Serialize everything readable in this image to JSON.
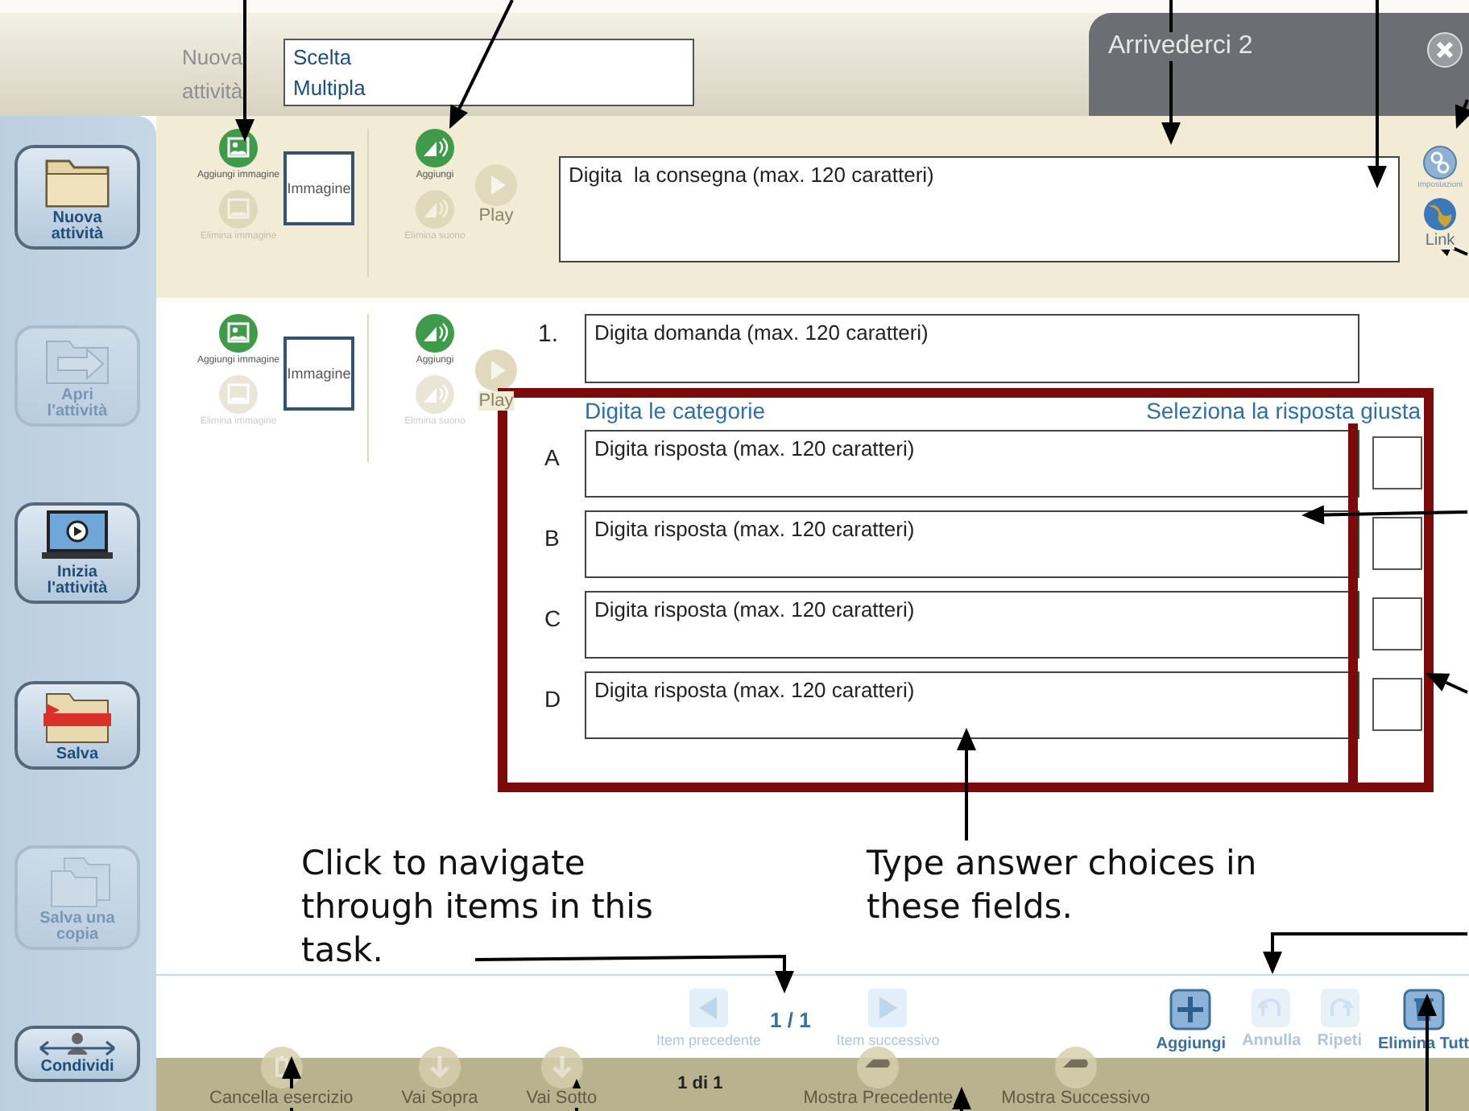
{
  "header": {
    "label": "Nuova attività",
    "activity_name_lines": [
      "Scelta",
      "Multipla"
    ]
  },
  "window_tab": {
    "title": "Arrivederci 2"
  },
  "sidebar": {
    "items": [
      {
        "kind": "new",
        "label": "Nuova attività",
        "disabled": false
      },
      {
        "kind": "open",
        "label": "Apri l'attività",
        "disabled": true
      },
      {
        "kind": "start",
        "label": "Inizia l'attività",
        "disabled": false
      },
      {
        "kind": "save",
        "label": "Salva",
        "disabled": false
      },
      {
        "kind": "copy",
        "label": "Salva una copia",
        "disabled": true
      },
      {
        "kind": "share",
        "label": "Condividi",
        "disabled": false
      }
    ]
  },
  "toolbar": {
    "image_tools": [
      {
        "label": "Aggiungi immagine",
        "disabled": false
      },
      {
        "label": "Elimina immagine",
        "disabled": true
      }
    ],
    "image_box": "Immagine",
    "sound_tools": [
      {
        "label": "Aggiungi",
        "disabled": false
      },
      {
        "label": "Elimina suono",
        "disabled": true
      }
    ],
    "play": {
      "label": "Play",
      "disabled": true
    },
    "instruction_field": {
      "placeholder": "Digita  la consegna (max. 120 caratteri)"
    },
    "settings": {
      "label": "Impostazioni"
    },
    "link": {
      "label": "Link"
    }
  },
  "question": {
    "image_tools": [
      {
        "label": "Aggiungi immagine",
        "disabled": false
      },
      {
        "label": "Elimina immagine",
        "disabled": true
      }
    ],
    "image_box": "Immagine",
    "sound_tools": [
      {
        "label": "Aggiungi",
        "disabled": false
      },
      {
        "label": "Elimina suono",
        "disabled": true
      }
    ],
    "play": {
      "label": "Play",
      "disabled": true
    },
    "number": "1.",
    "placeholder": "Digita domanda (max. 120 caratteri)",
    "categories_label": "Digita le categorie",
    "correct_label": "Seleziona la risposta giusta",
    "answers": [
      {
        "letter": "A",
        "placeholder": "Digita risposta (max. 120 caratteri)",
        "checked": false
      },
      {
        "letter": "B",
        "placeholder": "Digita risposta (max. 120 caratteri)",
        "checked": false
      },
      {
        "letter": "C",
        "placeholder": "Digita risposta (max. 120 caratteri)",
        "checked": false
      },
      {
        "letter": "D",
        "placeholder": "Digita risposta (max. 120 caratteri)",
        "checked": false
      }
    ]
  },
  "navigation": {
    "previous": {
      "label": "Item precedente",
      "disabled": true
    },
    "counter": "1 / 1",
    "next": {
      "label": "Item successivo",
      "disabled": true
    },
    "actions": [
      {
        "kind": "add",
        "label": "Aggiungi",
        "disabled": false
      },
      {
        "kind": "undo",
        "label": "Annulla",
        "disabled": true
      },
      {
        "kind": "redo",
        "label": "Ripeti",
        "disabled": true
      },
      {
        "kind": "delete",
        "label": "Elimina Tutt",
        "disabled": false
      }
    ]
  },
  "bottom_bar": {
    "items": [
      {
        "kind": "clear",
        "label": "Cancella esercizio",
        "disabled": true
      },
      {
        "kind": "up",
        "label": "Vai Sopra",
        "disabled": true
      },
      {
        "kind": "down",
        "label": "Vai Sotto",
        "disabled": true
      },
      {
        "kind": "counter",
        "label": "1 di 1",
        "disabled": false
      },
      {
        "kind": "previous",
        "label": "Mostra Precedente",
        "disabled": true
      },
      {
        "kind": "next",
        "label": "Mostra Successivo",
        "disabled": true
      }
    ]
  },
  "annotations": {
    "callouts": [
      "Click to navigate through items in this task.",
      "Type answer choices in these fields."
    ]
  }
}
